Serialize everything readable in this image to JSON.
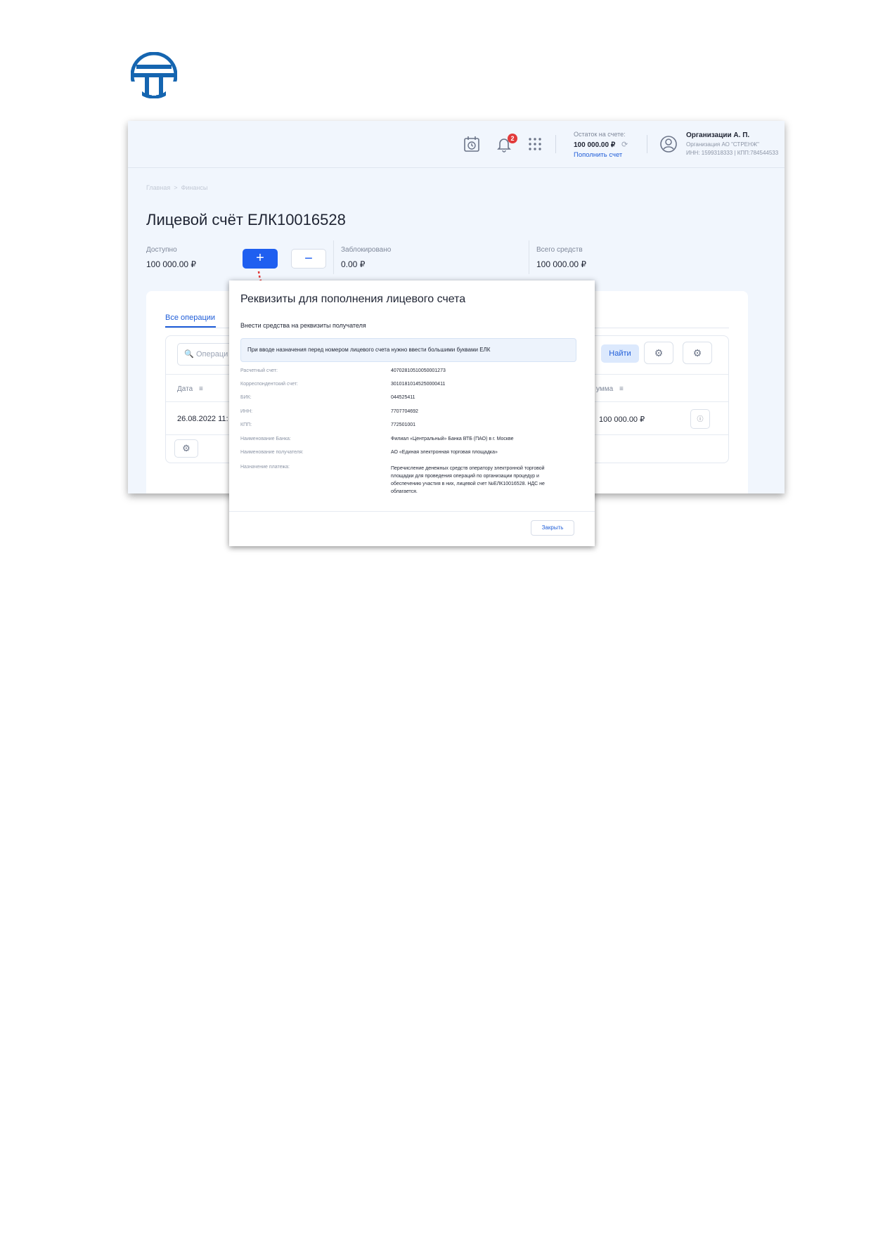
{
  "header": {
    "notifications_count": "2",
    "balance_label": "Остаток на счете:",
    "balance_value": "100 000.00 ₽",
    "topup_link": "Пополнить счет",
    "org_name": "Организации А. П.",
    "org_sub": "Организация АО \"СТРЕНЖ\"",
    "org_inn": "ИНН: 1599318333 | КПП:784544533"
  },
  "breadcrumb": {
    "home": "Главная",
    "separator": ">",
    "current": "Финансы"
  },
  "page": {
    "title": "Лицевой счёт ЕЛК10016528",
    "available_label": "Доступно",
    "available_value": "100 000.00 ₽",
    "blocked_label": "Заблокировано",
    "blocked_value": "0.00 ₽",
    "total_label": "Всего средств",
    "total_value": "100 000.00 ₽",
    "plus_label": "+",
    "minus_label": "−"
  },
  "operations": {
    "tab_all": "Все операции",
    "search_placeholder": "Операци",
    "find_button": "Найти",
    "col_date": "Дата",
    "col_sum": "умма",
    "rows": [
      {
        "date": "26.08.2022 11:",
        "sum": "100 000.00 ₽"
      }
    ]
  },
  "modal": {
    "title": "Реквизиты для пополнения лицевого счета",
    "subtitle": "Внести средства на реквизиты получателя",
    "note": "При вводе назначения перед номером лицевого счета нужно ввести большими буквами ЕЛК",
    "fields": [
      {
        "label": "Расчетный счет:",
        "value": "40702810510050001273"
      },
      {
        "label": "Корреспондентский счет:",
        "value": "30101810145250000411"
      },
      {
        "label": "БИК:",
        "value": "044525411"
      },
      {
        "label": "ИНН:",
        "value": "7707704692"
      },
      {
        "label": "КПП:",
        "value": "772501001"
      },
      {
        "label": "Наименование Банка:",
        "value": "Филиал «Центральный» Банка ВТБ (ПАО) в г. Москве"
      },
      {
        "label": "Наименование получателя:",
        "value": "АО «Единая электронная торговая площадка»"
      }
    ],
    "purpose_label": "Назначение платежа:",
    "purpose_value": "Перечисление денежных средств оператору электронной торговой площадки для проведения операций по организации процедур и обеспечению участия в них, лицевой счет №ЕЛК10016528. НДС не облагается.",
    "close_button": "Закрыть"
  },
  "colors": {
    "accent": "#1f5ff0",
    "brand_logo": "#1565b0",
    "arrow": "#e23b3b",
    "badge": "#e23b3b"
  },
  "icons": [
    "logo",
    "calendar-clock-icon",
    "bell-icon",
    "apps-grid-icon",
    "refresh-icon",
    "user-avatar-icon",
    "search-icon",
    "sort-icon",
    "gear-icon",
    "info-icon",
    "arrow-annotation"
  ]
}
